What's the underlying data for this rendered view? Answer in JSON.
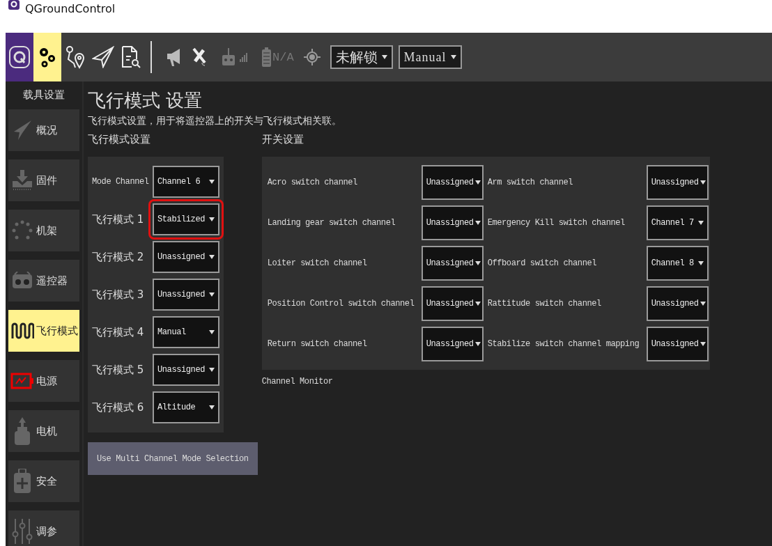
{
  "window": {
    "title": "QGroundControl"
  },
  "toolbar": {
    "tools": [
      {
        "selected": true
      },
      {
        "selected": false
      },
      {
        "selected": false
      },
      {
        "selected": false
      }
    ],
    "battery_text": "N/A",
    "arm_state": "未解锁",
    "flight_mode": "Manual"
  },
  "sidebar": {
    "heading": "载具设置",
    "items": [
      {
        "label": "概况",
        "selected": false
      },
      {
        "label": "固件",
        "selected": false
      },
      {
        "label": "机架",
        "selected": false
      },
      {
        "label": "遥控器",
        "selected": false
      },
      {
        "label": "飞行模式",
        "selected": true
      },
      {
        "label": "电源",
        "selected": false
      },
      {
        "label": "电机",
        "selected": false
      },
      {
        "label": "安全",
        "selected": false
      },
      {
        "label": "调参",
        "selected": false
      }
    ]
  },
  "page": {
    "title": "飞行模式 设置",
    "description": "飞行模式设置，用于将遥控器上的开关与飞行模式相关联。",
    "flight_modes": {
      "heading": "飞行模式设置",
      "rows": [
        {
          "label": "Mode Channel",
          "value": "Channel 6",
          "highlighted": false
        },
        {
          "label": "飞行模式 1",
          "value": "Stabilized",
          "highlighted": true
        },
        {
          "label": "飞行模式 2",
          "value": "Unassigned",
          "highlighted": false
        },
        {
          "label": "飞行模式 3",
          "value": "Unassigned",
          "highlighted": false
        },
        {
          "label": "飞行模式 4",
          "value": "Manual",
          "highlighted": false
        },
        {
          "label": "飞行模式 5",
          "value": "Unassigned",
          "highlighted": false
        },
        {
          "label": "飞行模式 6",
          "value": "Altitude",
          "highlighted": false
        }
      ]
    },
    "switches": {
      "heading": "开关设置",
      "items": [
        {
          "label": "Acro switch channel",
          "value": "Unassigned"
        },
        {
          "label": "Arm switch channel",
          "value": "Unassigned"
        },
        {
          "label": "Landing gear switch channel",
          "value": "Unassigned"
        },
        {
          "label": "Emergency Kill switch channel",
          "value": "Channel 7"
        },
        {
          "label": "Loiter switch channel",
          "value": "Unassigned"
        },
        {
          "label": "Offboard switch channel",
          "value": "Channel 8"
        },
        {
          "label": "Position Control switch channel",
          "value": "Unassigned"
        },
        {
          "label": "Rattitude switch channel",
          "value": "Unassigned"
        },
        {
          "label": "Return switch channel",
          "value": "Unassigned"
        },
        {
          "label": "Stabilize switch channel mapping",
          "value": "Unassigned"
        }
      ]
    },
    "channel_monitor": "Channel Monitor",
    "button": "Use Multi Channel Mode Selection"
  }
}
